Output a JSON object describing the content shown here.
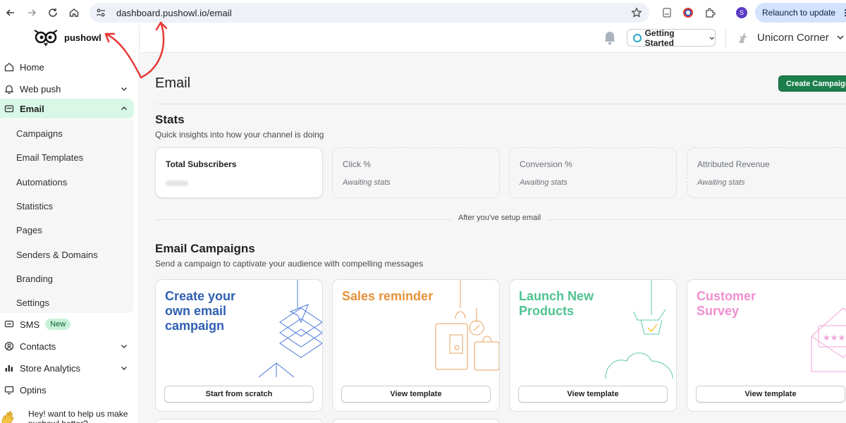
{
  "browser": {
    "url": "dashboard.pushowl.io/email",
    "profile_initial": "S",
    "relaunch_label": "Relaunch to update"
  },
  "app": {
    "logo_text": "pushowl"
  },
  "sidebar": {
    "items": [
      {
        "label": "Home",
        "icon": "home-icon"
      },
      {
        "label": "Web push",
        "icon": "bell-icon"
      },
      {
        "label": "Email",
        "icon": "mail-icon"
      },
      {
        "label": "SMS",
        "icon": "message-icon",
        "badge": "New"
      },
      {
        "label": "Contacts",
        "icon": "person-icon"
      },
      {
        "label": "Store Analytics",
        "icon": "bar-chart-icon"
      },
      {
        "label": "Optins",
        "icon": "monitor-icon"
      }
    ],
    "email_sub": [
      "Campaigns",
      "Email Templates",
      "Automations",
      "Statistics",
      "Pages",
      "Senders & Domains",
      "Branding",
      "Settings"
    ],
    "help_text": "Hey! want to help us make pushowl better?"
  },
  "header": {
    "getting_started": "Getting Started",
    "store_name": "Unicorn Corner"
  },
  "main": {
    "title": "Email",
    "create_button": "Create Campaign",
    "stats": {
      "title": "Stats",
      "subtitle": "Quick insights into how your channel is doing",
      "cards": [
        {
          "label": "Total Subscribers",
          "value": ""
        },
        {
          "label": "Click %",
          "value": "Awaiting stats"
        },
        {
          "label": "Conversion %",
          "value": "Awaiting stats"
        },
        {
          "label": "Attributed Revenue",
          "value": "Awaiting stats"
        }
      ],
      "after_setup": "After you've setup email"
    },
    "campaigns": {
      "title": "Email Campaigns",
      "subtitle": "Send a campaign to captivate your audience with compelling messages",
      "cards": [
        {
          "title": "Create your own email campaign",
          "button": "Start from scratch",
          "color": "#2f5fb3"
        },
        {
          "title": "Sales reminder",
          "button": "View template",
          "color": "#e8923a"
        },
        {
          "title": "Launch New Products",
          "button": "View template",
          "color": "#4fc392"
        },
        {
          "title": "Customer Survey",
          "button": "View template",
          "color": "#f08fd0"
        }
      ]
    }
  },
  "colors": {
    "accent_green": "#1b7f4b",
    "active_nav_bg": "#d9f7e6",
    "annotation_red": "#e53935"
  }
}
